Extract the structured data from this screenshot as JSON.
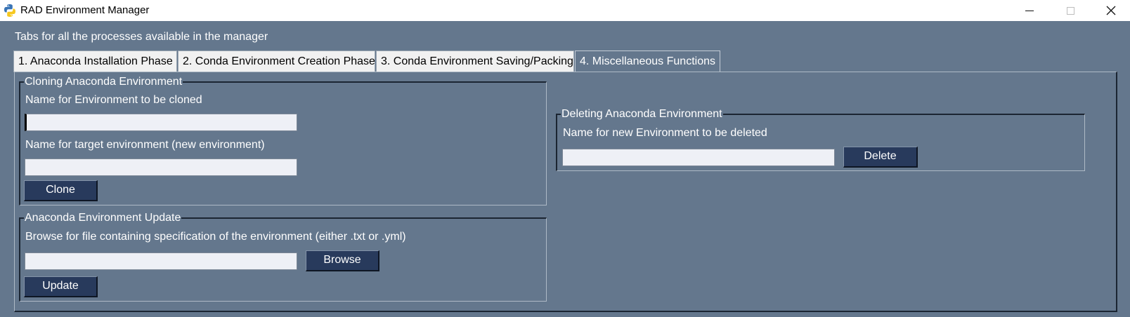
{
  "window": {
    "title": "RAD Environment Manager",
    "controls": {
      "minimize": "minimize",
      "maximize": "maximize",
      "close": "close"
    }
  },
  "notebook_label": "Tabs for all the processes available in the manager",
  "tabs": [
    {
      "label": "1. Anaconda Installation Phase",
      "active": false
    },
    {
      "label": "2. Conda Environment Creation Phase",
      "active": false
    },
    {
      "label": "3. Conda Environment Saving/Packing",
      "active": false
    },
    {
      "label": "4. Miscellaneous Functions",
      "active": true
    }
  ],
  "clone_frame": {
    "title": "Cloning Anaconda Environment",
    "source_label": "Name for Environment to be cloned",
    "source_value": "",
    "target_label": "Name for target environment (new environment)",
    "target_value": "",
    "clone_button": "Clone"
  },
  "update_frame": {
    "title": "Anaconda Environment Update",
    "browse_label": "Browse for file containing specification of the environment (either .txt or .yml)",
    "file_value": "",
    "browse_button": "Browse",
    "update_button": "Update"
  },
  "delete_frame": {
    "title": "Deleting Anaconda Environment",
    "name_label": "Name for new Environment to be deleted",
    "name_value": "",
    "delete_button": "Delete"
  },
  "colors": {
    "background": "#64778d",
    "button": "#283a5c",
    "entry": "#eef0f6",
    "text": "#ffffff"
  },
  "icons": {
    "app": "python-logo-icon"
  }
}
